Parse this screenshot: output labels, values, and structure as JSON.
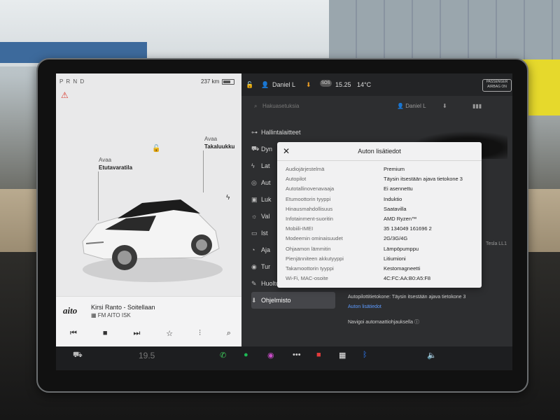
{
  "car_panel": {
    "gear": "P R N D",
    "range": "237 km",
    "frunk": {
      "line1": "Avaa",
      "line2": "Etutavaratila"
    },
    "trunk": {
      "line1": "Avaa",
      "line2": "Takaluukku"
    }
  },
  "media": {
    "logo": "aito",
    "song": "Kirsi Ranto - Soitellaan",
    "station": "FM AITO ISK"
  },
  "topbar": {
    "user": "Daniel L",
    "time": "15.25",
    "temp": "14°C",
    "sos": "SOS",
    "airbag": "PASSENGER AIRBAG ON"
  },
  "search": {
    "placeholder": "Hakuasetuksia",
    "user": "Daniel L"
  },
  "menu": [
    {
      "label": "Hallintalaitteet",
      "icon": "toggle-icon"
    },
    {
      "label": "Dyn",
      "icon": "car-icon"
    },
    {
      "label": "Lat",
      "icon": "charging-icon"
    },
    {
      "label": "Aut",
      "icon": "steering-icon"
    },
    {
      "label": "Luk",
      "icon": "lock-icon"
    },
    {
      "label": "Val",
      "icon": "light-icon"
    },
    {
      "label": "Ist",
      "icon": "display-icon"
    },
    {
      "label": "Aja",
      "icon": "trip-icon"
    },
    {
      "label": "Tur",
      "icon": "safety-icon"
    },
    {
      "label": "Huolto",
      "icon": "wrench-icon"
    },
    {
      "label": "Ohjelmisto",
      "icon": "download-icon"
    }
  ],
  "modal": {
    "title": "Auton lisätiedot",
    "rows": [
      {
        "key": "Audiojärjestelmä",
        "value": "Premium"
      },
      {
        "key": "Autopilot",
        "value": "Täysin itsestään ajava tietokone 3"
      },
      {
        "key": "Autotallinovenavaaja",
        "value": "Ei asennettu"
      },
      {
        "key": "Etumoottorin tyyppi",
        "value": "Induktio"
      },
      {
        "key": "Hinausmahdollisuus",
        "value": "Saatavilla"
      },
      {
        "key": "Infotainment-suoritin",
        "value": "AMD Ryzen™"
      },
      {
        "key": "Mobiili-IMEI",
        "value": "35 134049 161696 2"
      },
      {
        "key": "Modeemin ominaisuudet",
        "value": "2G/3G/4G"
      },
      {
        "key": "Ohjaamon lämmitin",
        "value": "Lämpöpumppu"
      },
      {
        "key": "Pienjänniteen akkutyyppi",
        "value": "Litiumioni"
      },
      {
        "key": "Takamoottorin tyyppi",
        "value": "Kestomagneetti"
      },
      {
        "key": "Wi-Fi, MAC-osoite",
        "value": "4C:FC:AA:B0:A5:F8"
      }
    ]
  },
  "details": {
    "autopilot_computer": "Autopilottitietokone: Täysin itsestään ajava tietokone 3",
    "details_link": "Auton lisätiedot",
    "nav_auto": "Navigoi automaattiohjauksella",
    "model_fragment": "Tesla LL1"
  },
  "taskbar": {
    "temp": "19.5"
  },
  "colors": {
    "accent_link": "#5d9bff",
    "seatbelt_warning": "#d93a2f",
    "download_arrow": "#e89b25"
  }
}
